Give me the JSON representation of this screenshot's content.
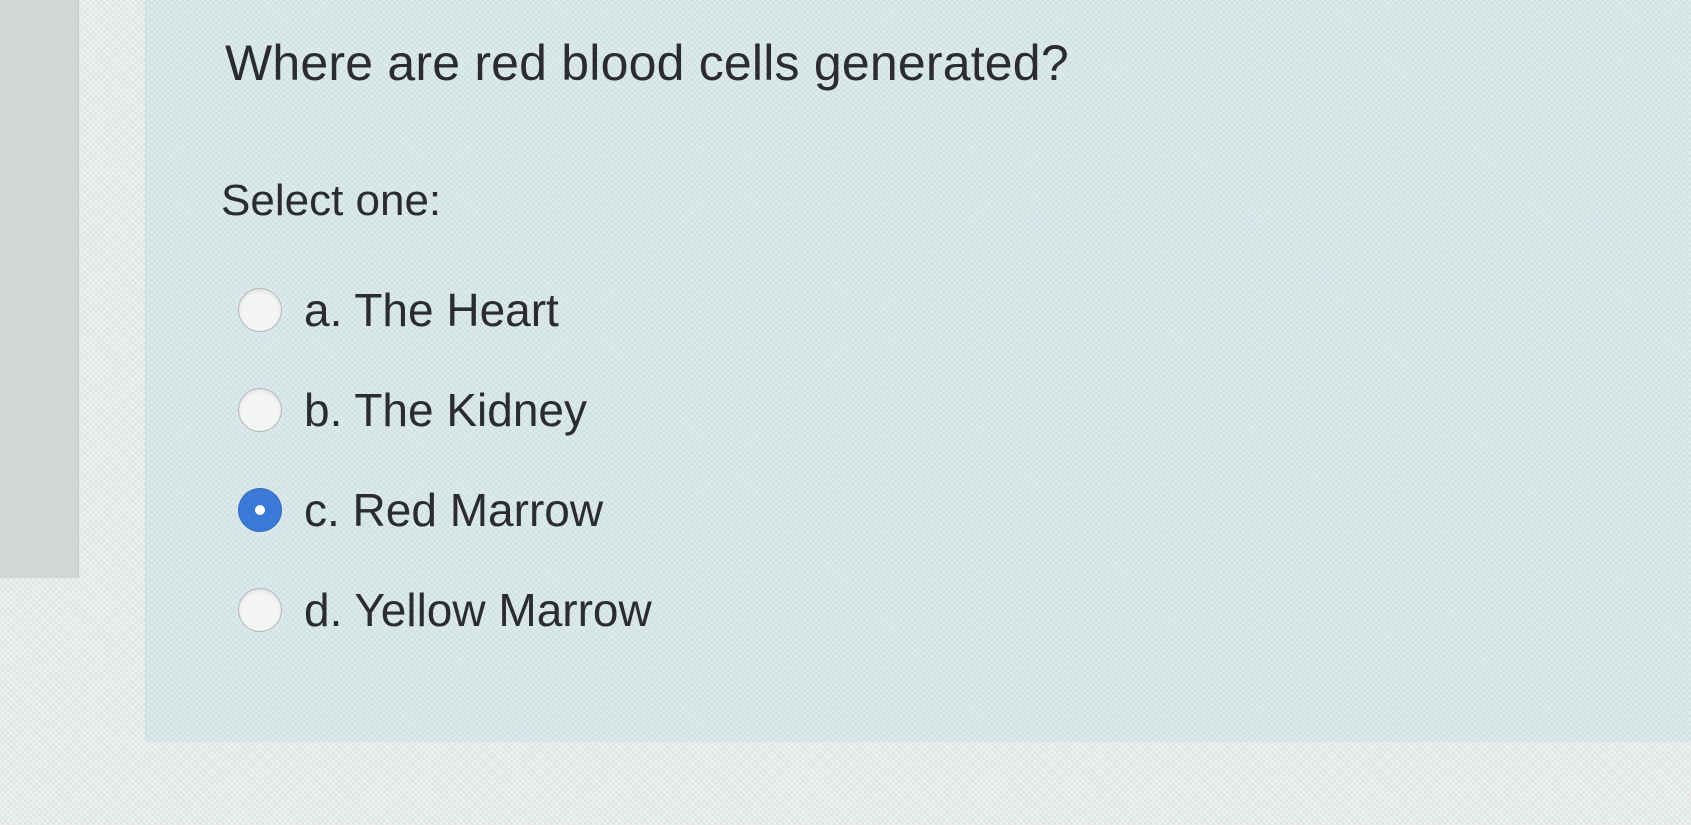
{
  "question": {
    "text": "Where are red blood cells generated?",
    "prompt": "Select one:"
  },
  "answers": [
    {
      "label": "a. The Heart",
      "selected": false
    },
    {
      "label": "b. The Kidney",
      "selected": false
    },
    {
      "label": "c. Red Marrow",
      "selected": true
    },
    {
      "label": "d. Yellow Marrow",
      "selected": false
    }
  ],
  "colors": {
    "panel_background": "#d6e7ea",
    "selected_radio": "#3a7ad6",
    "text": "#2a2c2d"
  }
}
